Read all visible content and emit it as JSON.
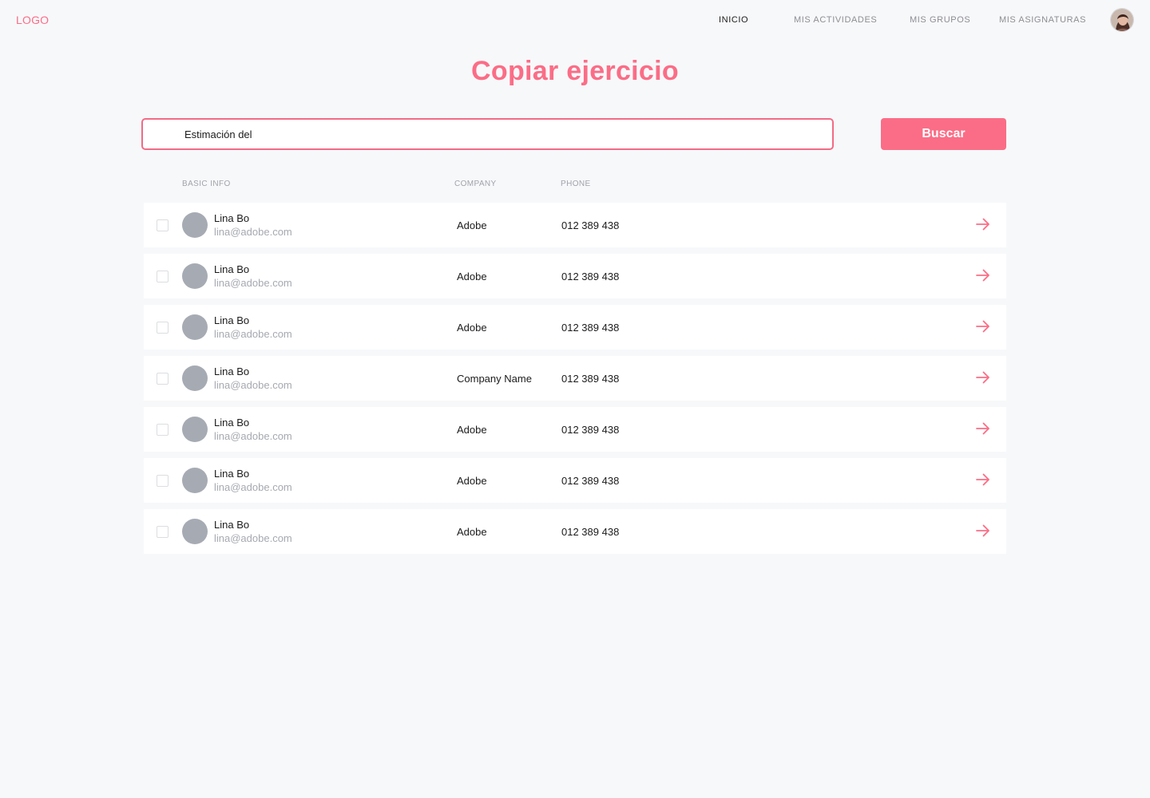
{
  "header": {
    "logo": "LOGO",
    "nav": [
      {
        "label": "INICIO",
        "active": true
      },
      {
        "label": "MIS ACTIVIDADES",
        "active": false
      },
      {
        "label": "MIS GRUPOS",
        "active": false
      },
      {
        "label": "MIS ASIGNATURAS",
        "active": false
      }
    ]
  },
  "page": {
    "title": "Copiar ejercicio"
  },
  "search": {
    "value": "Estimación del",
    "button_label": "Buscar"
  },
  "table": {
    "headers": {
      "basic_info": "BASIC INFO",
      "company": "COMPANY",
      "phone": "PHONE"
    },
    "rows": [
      {
        "name": "Lina Bo",
        "email": "lina@adobe.com",
        "company": "Adobe",
        "phone": "012 389 438"
      },
      {
        "name": "Lina Bo",
        "email": "lina@adobe.com",
        "company": "Adobe",
        "phone": "012 389 438"
      },
      {
        "name": "Lina Bo",
        "email": "lina@adobe.com",
        "company": "Adobe",
        "phone": "012 389 438"
      },
      {
        "name": "Lina Bo",
        "email": "lina@adobe.com",
        "company": "Company Name",
        "phone": "012 389 438"
      },
      {
        "name": "Lina Bo",
        "email": "lina@adobe.com",
        "company": "Adobe",
        "phone": "012 389 438"
      },
      {
        "name": "Lina Bo",
        "email": "lina@adobe.com",
        "company": "Adobe",
        "phone": "012 389 438"
      },
      {
        "name": "Lina Bo",
        "email": "lina@adobe.com",
        "company": "Adobe",
        "phone": "012 389 438"
      }
    ]
  },
  "colors": {
    "accent": "#fb6d86",
    "background": "#f7f8fa",
    "avatar_placeholder": "#a6abb3"
  },
  "icons": {
    "row_action": "arrow-right-icon",
    "user": "user-avatar"
  }
}
